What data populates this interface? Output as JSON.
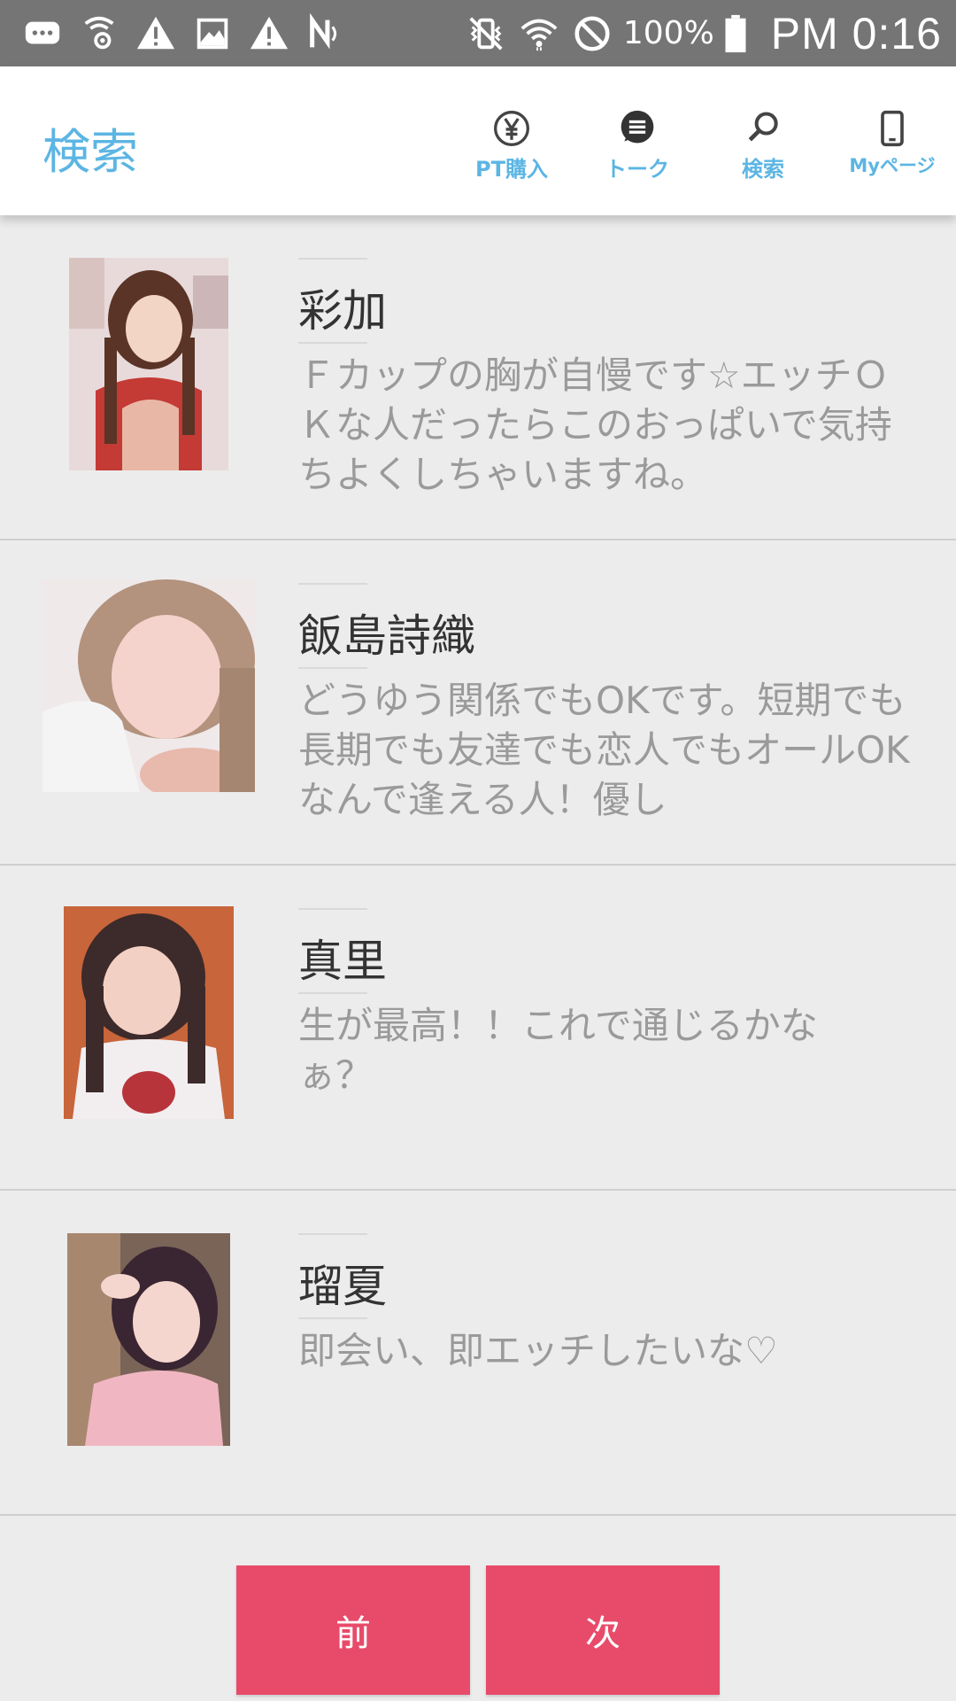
{
  "status_bar": {
    "battery_percent": "100%",
    "time": "PM 0:16",
    "left_icons": [
      "chat-bubble-icon",
      "settings-signal-icon",
      "warning-icon",
      "image-icon",
      "warning-icon",
      "nfc-icon"
    ],
    "right_icons": [
      "vibrate-mute-icon",
      "wifi-icon",
      "do-not-disturb-icon",
      "battery-icon"
    ]
  },
  "header": {
    "title": "検索",
    "nav": [
      {
        "label": "PT購入",
        "icon": "yen-icon"
      },
      {
        "label": "トーク",
        "icon": "chat-icon"
      },
      {
        "label": "検索",
        "icon": "search-icon"
      },
      {
        "label": "Myページ",
        "icon": "phone-icon"
      }
    ]
  },
  "list": [
    {
      "name": "彩加",
      "description": "Ｆカップの胸が自慢です☆エッチＯＫな人だったらこのおっぱいで気持ちよくしちゃいますね。"
    },
    {
      "name": "飯島詩織",
      "description": "どうゆう関係でもOKです。短期でも長期でも友達でも恋人でもオールOKなんで逢える人！優し"
    },
    {
      "name": "真里",
      "description": "生が最高！！これで通じるかなぁ？"
    },
    {
      "name": "瑠夏",
      "description": "即会い、即エッチしたいな♡"
    }
  ],
  "pager": {
    "prev_label": "前",
    "next_label": "次"
  },
  "colors": {
    "accent": "#5cb5e3",
    "button": "#e84b6a",
    "background": "#ececec"
  }
}
